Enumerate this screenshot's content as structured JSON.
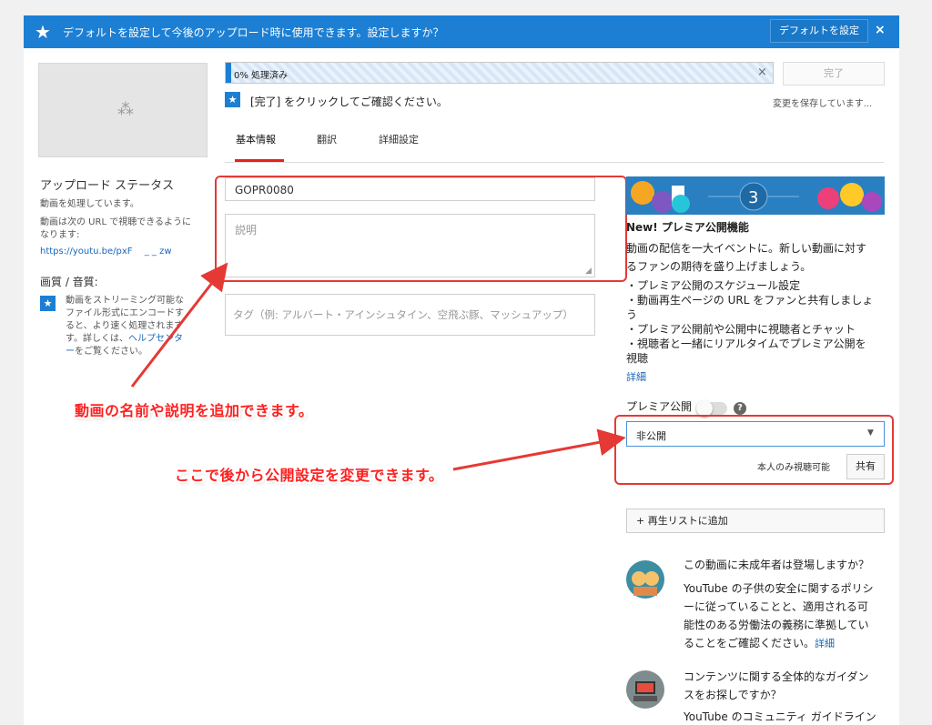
{
  "banner": {
    "message": "デフォルトを設定して今後のアップロード時に使用できます。設定しますか？",
    "set_default_label": "デフォルトを設定",
    "close_glyph": "×",
    "star_glyph": "★"
  },
  "left": {
    "upload_status_title": "アップロード ステータス",
    "processing_text": "動画を処理しています。",
    "url_text_1": "動画は次の URL で視聴できるように",
    "url_text_2": "なります:",
    "url_link": "https://youtu.be/pxF　 _ _ zw",
    "quality_title": "画質 / 音質:",
    "quality_lines": [
      "動画をストリーミング可能な",
      "ファイル形式にエンコードす",
      "ると、より速く処理されます",
      "す。詳しくは、"
    ],
    "help_link_1": "ヘルプセンタ",
    "help_link_2": "ー",
    "help_suffix": "をご覧ください。"
  },
  "progress": {
    "text": "0% 処理済み",
    "percent": 1,
    "cancel_glyph": "×",
    "done_label": "完了"
  },
  "notice": {
    "text": "[完了] をクリックしてご確認ください。",
    "saving": "変更を保存しています..."
  },
  "tabs": [
    {
      "label": "基本情報"
    },
    {
      "label": "翻訳"
    },
    {
      "label": "詳細設定"
    }
  ],
  "form": {
    "title_value": "GOPR0080",
    "description_placeholder": "説明",
    "tags_placeholder": "タグ（例: アルバート・アインシュタイン、空飛ぶ豚、マッシュアップ）"
  },
  "promo": {
    "number": "3",
    "title": "New! プレミア公開機能",
    "desc_lines": [
      "動画の配信を一大イベントに。新しい動画に対す",
      "るファンの期待を盛り上げましょう。"
    ],
    "bullets": [
      "・プレミア公開のスケジュール設定",
      "・動画再生ページの URL をファンと共有しましょ",
      "う",
      "・プレミア公開前や公開中に視聴者とチャット",
      "・視聴者と一緒にリアルタイムでプレミア公開を",
      "視聴"
    ],
    "details_link": "詳細"
  },
  "premiere": {
    "label": "プレミア公開",
    "help_glyph": "?",
    "enabled": false
  },
  "privacy": {
    "selected": "非公開",
    "note": "本人のみ視聴可能",
    "share_label": "共有",
    "caret": "▼"
  },
  "playlist": {
    "label": "+ 再生リストに追加"
  },
  "minors": {
    "question": "この動画に未成年者は登場しますか？",
    "lines": [
      "YouTube の子供の安全に関するポリシ",
      "ーに従っていることと、適用される可",
      "能性のある労働法の義務に準拠してい",
      "ることをご確認ください。"
    ],
    "link": "詳細"
  },
  "guidelines": {
    "question_lines": [
      "コンテンツに関する全体的なガイダン",
      "スをお探しですか？"
    ],
    "line": "YouTube のコミュニティ ガイドライン"
  },
  "annotations": {
    "name_desc": "動画の名前や説明を追加できます。",
    "privacy_change": "ここで後から公開設定を変更できます。",
    "color": "#ff2020"
  },
  "colors": {
    "accent": "#1c7fd4",
    "tab_underline": "#e62117",
    "link": "#1a66b8"
  }
}
